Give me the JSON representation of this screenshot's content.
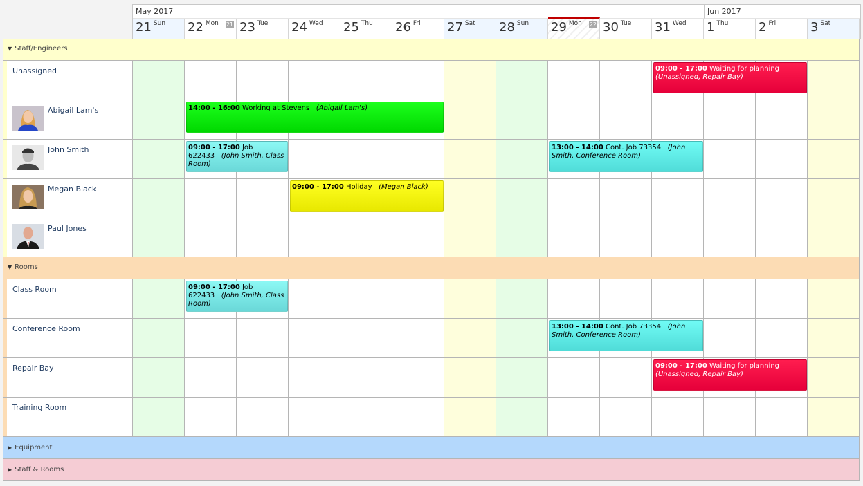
{
  "header": {
    "months": [
      {
        "label": "May 2017"
      },
      {
        "label": "Jun 2017"
      }
    ],
    "days": [
      {
        "num": "21",
        "name": "Sun",
        "type": "sun"
      },
      {
        "num": "22",
        "name": "Mon",
        "type": "weekday",
        "week": "21"
      },
      {
        "num": "23",
        "name": "Tue",
        "type": "weekday"
      },
      {
        "num": "24",
        "name": "Wed",
        "type": "weekday"
      },
      {
        "num": "25",
        "name": "Thu",
        "type": "weekday"
      },
      {
        "num": "26",
        "name": "Fri",
        "type": "weekday"
      },
      {
        "num": "27",
        "name": "Sat",
        "type": "sat"
      },
      {
        "num": "28",
        "name": "Sun",
        "type": "sun"
      },
      {
        "num": "29",
        "name": "Mon",
        "type": "today",
        "week": "22"
      },
      {
        "num": "30",
        "name": "Tue",
        "type": "weekday"
      },
      {
        "num": "31",
        "name": "Wed",
        "type": "weekday"
      },
      {
        "num": "1",
        "name": "Thu",
        "type": "weekday"
      },
      {
        "num": "2",
        "name": "Fri",
        "type": "weekday"
      },
      {
        "num": "3",
        "name": "Sat",
        "type": "sat"
      }
    ]
  },
  "groups": [
    {
      "label": "Staff/Engineers",
      "expanded": true,
      "color": "#ffffcc"
    },
    {
      "label": "Rooms",
      "expanded": true,
      "color": "#fcdcb4"
    },
    {
      "label": "Equipment",
      "expanded": false,
      "color": "#b4d8fc"
    },
    {
      "label": "Staff & Rooms",
      "expanded": false,
      "color": "#f5ccd4"
    }
  ],
  "resources": {
    "staff": [
      {
        "name": "Unassigned",
        "avatar": null
      },
      {
        "name": "Abigail Lam's",
        "avatar": "woman-blonde"
      },
      {
        "name": "John Smith",
        "avatar": "man-bw"
      },
      {
        "name": "Megan Black",
        "avatar": "woman-brown"
      },
      {
        "name": "Paul Jones",
        "avatar": "man-bald"
      }
    ],
    "rooms": [
      {
        "name": "Class Room"
      },
      {
        "name": "Conference Room"
      },
      {
        "name": "Repair Bay"
      },
      {
        "name": "Training Room"
      }
    ]
  },
  "events": [
    {
      "id": "ev-unassigned",
      "time": "09:00 - 17:00",
      "title": "Waiting for planning",
      "who": "(Unassigned, Repair Bay)",
      "color": "red"
    },
    {
      "id": "ev-abigail",
      "time": "14:00 - 16:00",
      "title": "Working at Stevens",
      "who": "(Abigail Lam's)",
      "color": "green"
    },
    {
      "id": "ev-john-1",
      "time": "09:00 - 17:00",
      "title": "Job 622433",
      "who": "(John Smith, Class Room)",
      "color": "cyan"
    },
    {
      "id": "ev-john-2",
      "time": "13:00 - 14:00",
      "title": "Cont. Job 73354",
      "who": "(John Smith, Conference Room)",
      "color": "cyan2"
    },
    {
      "id": "ev-megan",
      "time": "09:00 - 17:00",
      "title": "Holiday",
      "who": "(Megan Black)",
      "color": "yellow"
    },
    {
      "id": "ev-classroom",
      "time": "09:00 - 17:00",
      "title": "Job 622433",
      "who": "(John Smith, Class Room)",
      "color": "cyan"
    },
    {
      "id": "ev-conference",
      "time": "13:00 - 14:00",
      "title": "Cont. Job 73354",
      "who": "(John Smith, Conference Room)",
      "color": "cyan2"
    },
    {
      "id": "ev-repairbay",
      "time": "09:00 - 17:00",
      "title": "Waiting for planning",
      "who": "(Unassigned, Repair Bay)",
      "color": "red"
    }
  ],
  "colors": {
    "staff_group": "#ffffcc",
    "rooms_group": "#fcdcb4",
    "equipment_group": "#b4d8fc",
    "staffrooms_group": "#f5ccd4",
    "today_marker": "#c00000",
    "sunday_column": "#e6fde6",
    "saturday_column": "#fefedc"
  }
}
